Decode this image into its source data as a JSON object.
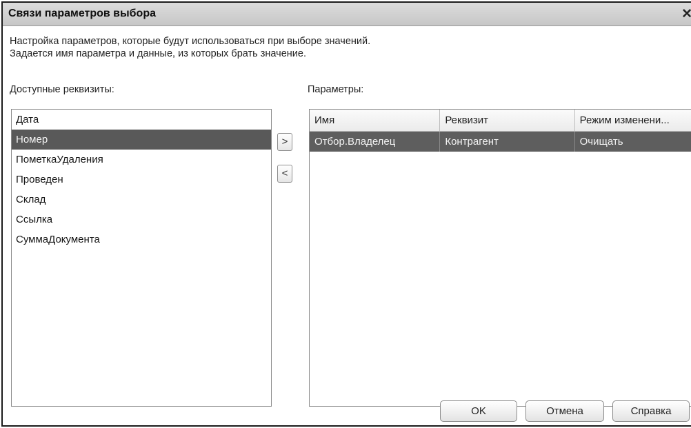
{
  "window": {
    "title": "Связи параметров выбора",
    "close_symbol": "✕"
  },
  "description": {
    "line1": "Настройка параметров, которые будут использоваться при выборе значений.",
    "line2": "Задается имя параметра и данные, из которых брать значение."
  },
  "available": {
    "label": "Доступные реквизиты:",
    "items": [
      "Дата",
      "Номер",
      "ПометкаУдаления",
      "Проведен",
      "Склад",
      "Ссылка",
      "СуммаДокумента"
    ],
    "selected_item": "Номер"
  },
  "move_buttons": {
    "add": ">",
    "remove": "<"
  },
  "parameters": {
    "label": "Параметры:",
    "columns": [
      "Имя",
      "Реквизит",
      "Режим изменени..."
    ],
    "rows": [
      [
        "Отбор.Владелец",
        "Контрагент",
        "Очищать"
      ]
    ]
  },
  "buttons": {
    "ok": "OK",
    "cancel": "Отмена",
    "help": "Справка"
  },
  "colors": {
    "selection": "#595959",
    "titlebar": "#d0d0d0"
  }
}
